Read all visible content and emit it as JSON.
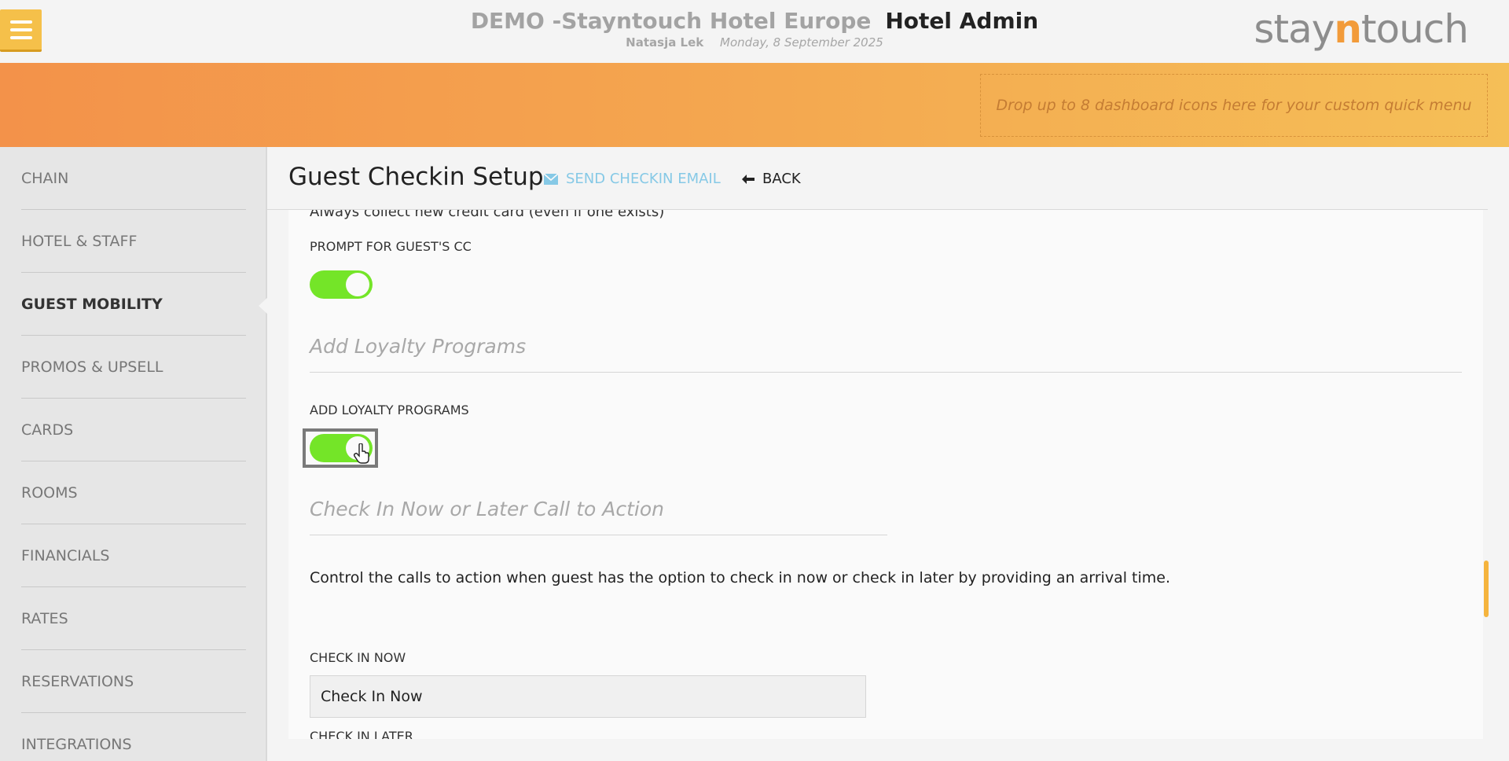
{
  "header": {
    "hotel_name": "DEMO -Stayntouch Hotel Europe",
    "app_title": "Hotel Admin",
    "user_name": "Natasja Lek",
    "date": "Monday, 8 September 2025",
    "logo_prefix": "stay",
    "logo_highlight": "n",
    "logo_suffix": "touch"
  },
  "quick_menu": {
    "placeholder": "Drop up to 8 dashboard icons here for your custom quick menu"
  },
  "sidebar": {
    "items": [
      {
        "label": "CHAIN"
      },
      {
        "label": "HOTEL & STAFF"
      },
      {
        "label": "GUEST MOBILITY"
      },
      {
        "label": "PROMOS & UPSELL"
      },
      {
        "label": "CARDS"
      },
      {
        "label": "ROOMS"
      },
      {
        "label": "FINANCIALS"
      },
      {
        "label": "RATES"
      },
      {
        "label": "RESERVATIONS"
      },
      {
        "label": "INTEGRATIONS"
      }
    ],
    "active": "GUEST MOBILITY"
  },
  "page": {
    "title": "Guest Checkin Setup",
    "send_email_label": "SEND CHECKIN EMAIL",
    "back_label": "BACK"
  },
  "content": {
    "cut_text": "Always collect new credit card (even if one exists)",
    "prompt_cc_label": "PROMPT FOR GUEST'S CC",
    "prompt_cc_on": true,
    "loyalty_section_title": "Add Loyalty Programs",
    "loyalty_label": "ADD LOYALTY PROGRAMS",
    "loyalty_on": true,
    "cta_section_title": "Check In Now or Later Call to Action",
    "cta_description": "Control the calls to action when guest has the option to check in now or check in later by providing an arrival time.",
    "check_in_now_label": "CHECK IN NOW",
    "check_in_now_value": "Check In Now",
    "check_in_later_label": "CHECK IN LATER"
  },
  "colors": {
    "accent_orange": "#f3924a",
    "toggle_on": "#74e528",
    "link_blue": "#86c9e6"
  }
}
